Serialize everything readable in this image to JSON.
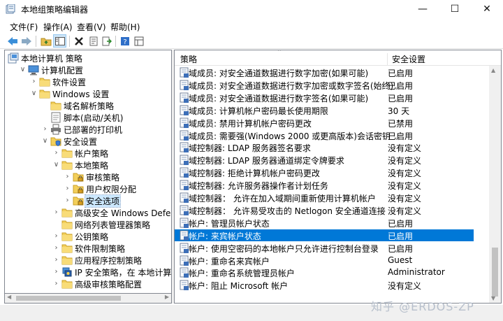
{
  "window": {
    "title": "本地组策略编辑器",
    "minimize": "—",
    "maximize": "☐",
    "close": "✕"
  },
  "menu": [
    {
      "label": "文件(F)"
    },
    {
      "label": "操作(A)"
    },
    {
      "label": "查看(V)"
    },
    {
      "label": "帮助(H)"
    }
  ],
  "toolbar": [
    "back-icon",
    "forward-icon",
    "folder-up-icon",
    "show-hide-tree-icon",
    "delete-icon",
    "properties-icon",
    "export-icon",
    "help-icon",
    "view-icon"
  ],
  "tree": [
    {
      "label": "本地计算机 策略",
      "level": 0,
      "exp": "",
      "icon": "computer-policy-icon"
    },
    {
      "label": "计算机配置",
      "level": 1,
      "exp": "∨",
      "icon": "computer-icon"
    },
    {
      "label": "软件设置",
      "level": 2,
      "exp": "›",
      "icon": "folder-icon"
    },
    {
      "label": "Windows 设置",
      "level": 2,
      "exp": "∨",
      "icon": "folder-icon"
    },
    {
      "label": "域名解析策略",
      "level": 3,
      "exp": "",
      "icon": "folder-icon"
    },
    {
      "label": "脚本(启动/关机)",
      "level": 3,
      "exp": "",
      "icon": "script-icon"
    },
    {
      "label": "已部署的打印机",
      "level": 3,
      "exp": "›",
      "icon": "printer-icon"
    },
    {
      "label": "安全设置",
      "level": 3,
      "exp": "∨",
      "icon": "security-icon"
    },
    {
      "label": "帐户策略",
      "level": 4,
      "exp": "›",
      "icon": "folder-icon"
    },
    {
      "label": "本地策略",
      "level": 4,
      "exp": "∨",
      "icon": "folder-icon"
    },
    {
      "label": "审核策略",
      "level": 5,
      "exp": "›",
      "icon": "lock-folder-icon"
    },
    {
      "label": "用户权限分配",
      "level": 5,
      "exp": "›",
      "icon": "lock-folder-icon"
    },
    {
      "label": "安全选项",
      "level": 5,
      "exp": "›",
      "icon": "lock-folder-icon",
      "selected": true
    },
    {
      "label": "高级安全 Windows Defende",
      "level": 4,
      "exp": "›",
      "icon": "folder-icon"
    },
    {
      "label": "网络列表管理器策略",
      "level": 4,
      "exp": "",
      "icon": "folder-icon"
    },
    {
      "label": "公钥策略",
      "level": 4,
      "exp": "›",
      "icon": "folder-icon"
    },
    {
      "label": "软件限制策略",
      "level": 4,
      "exp": "›",
      "icon": "folder-icon"
    },
    {
      "label": "应用程序控制策略",
      "level": 4,
      "exp": "›",
      "icon": "folder-icon"
    },
    {
      "label": "IP 安全策略，在 本地计算机",
      "level": 4,
      "exp": "›",
      "icon": "ipsec-icon"
    },
    {
      "label": "高级审核策略配置",
      "level": 4,
      "exp": "›",
      "icon": "folder-icon"
    }
  ],
  "list": {
    "col_policy": "策略",
    "col_setting": "安全设置",
    "rows": [
      {
        "policy": "域成员: 对安全通道数据进行数字加密(如果可能)",
        "setting": "已启用"
      },
      {
        "policy": "域成员: 对安全通道数据进行数字加密或数字签名(始终)",
        "setting": "已启用"
      },
      {
        "policy": "域成员: 对安全通道数据进行数字签名(如果可能)",
        "setting": "已启用"
      },
      {
        "policy": "域成员: 计算机帐户密码最长使用期限",
        "setting": "30 天"
      },
      {
        "policy": "域成员: 禁用计算机帐户密码更改",
        "setting": "已禁用"
      },
      {
        "policy": "域成员: 需要强(Windows 2000 或更高版本)会话密钥",
        "setting": "已启用"
      },
      {
        "policy": "域控制器: LDAP 服务器签名要求",
        "setting": "没有定义"
      },
      {
        "policy": "域控制器: LDAP 服务器通道绑定令牌要求",
        "setting": "没有定义"
      },
      {
        "policy": "域控制器: 拒绝计算机帐户密码更改",
        "setting": "没有定义"
      },
      {
        "policy": "域控制器: 允许服务器操作者计划任务",
        "setting": "没有定义"
      },
      {
        "policy": "域控制器：  允许在加入域期间重新使用计算机帐户",
        "setting": "没有定义"
      },
      {
        "policy": "域控制器：  允许易受攻击的 Netlogon 安全通道连接",
        "setting": "没有定义"
      },
      {
        "policy": "帐户: 管理员帐户状态",
        "setting": "已启用"
      },
      {
        "policy": "帐户: 来宾帐户状态",
        "setting": "已启用",
        "selected": true
      },
      {
        "policy": "帐户: 使用空密码的本地帐户只允许进行控制台登录",
        "setting": "已启用"
      },
      {
        "policy": "帐户: 重命名来宾帐户",
        "setting": "Guest"
      },
      {
        "policy": "帐户: 重命名系统管理员帐户",
        "setting": "Administrator"
      },
      {
        "policy": "帐户: 阻止 Microsoft 帐户",
        "setting": "没有定义"
      }
    ]
  },
  "watermark": "知乎 @ERDOS-ZP",
  "colors": {
    "selection": "#0078d7",
    "tree_selection": "#cce8ff"
  }
}
